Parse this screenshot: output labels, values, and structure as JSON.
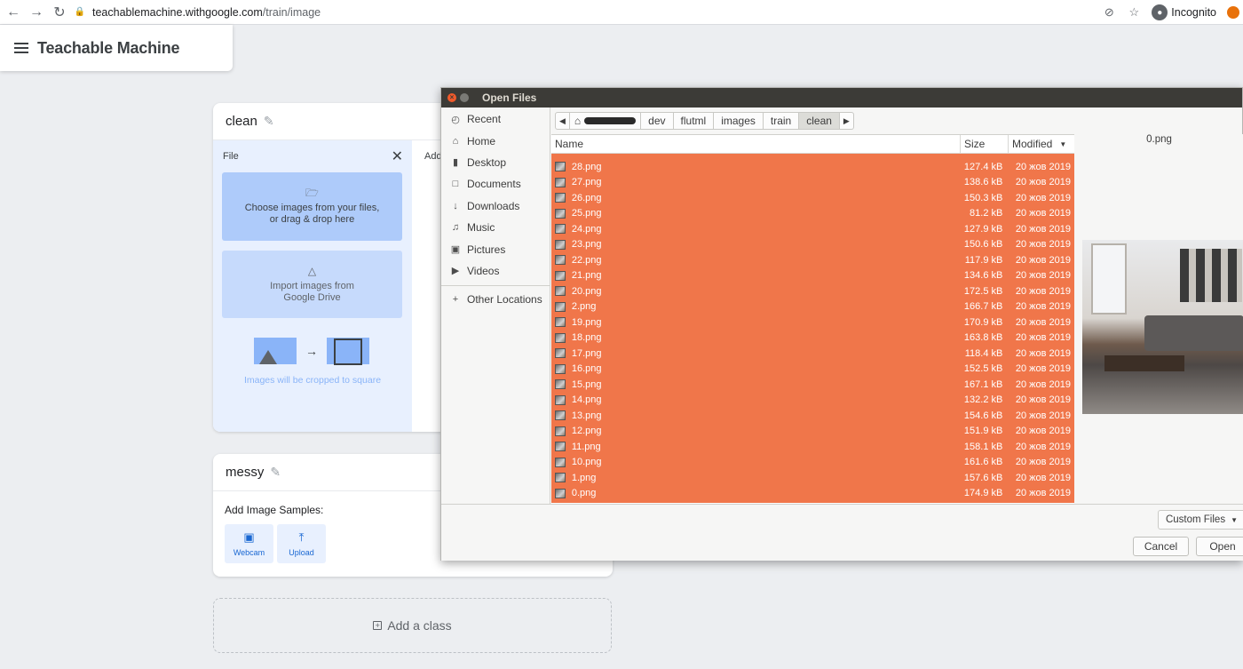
{
  "browser": {
    "url_domain": "teachablemachine.withgoogle.com",
    "url_path": "/train/image",
    "profile_label": "Incognito"
  },
  "app": {
    "title": "Teachable Machine"
  },
  "classes": [
    {
      "name": "clean",
      "file_panel": {
        "label": "File",
        "choose_text_line1": "Choose images from your files,",
        "choose_text_line2": "or drag & drop here",
        "drive_text_line1": "Import images from",
        "drive_text_line2": "Google Drive",
        "crop_note": "Images will be cropped to square"
      },
      "add_label_partial": "Add"
    },
    {
      "name": "messy",
      "samples_label": "Add Image Samples:",
      "webcam_label": "Webcam",
      "upload_label": "Upload"
    }
  ],
  "add_class_label": "Add a class",
  "dialog": {
    "title": "Open Files",
    "places": [
      {
        "label": "Recent",
        "icon": "clock-icon"
      },
      {
        "label": "Home",
        "icon": "home-icon"
      },
      {
        "label": "Desktop",
        "icon": "folder-icon"
      },
      {
        "label": "Documents",
        "icon": "document-icon"
      },
      {
        "label": "Downloads",
        "icon": "download-icon"
      },
      {
        "label": "Music",
        "icon": "music-icon"
      },
      {
        "label": "Pictures",
        "icon": "camera-icon"
      },
      {
        "label": "Videos",
        "icon": "video-icon"
      }
    ],
    "other_locations": "Other Locations",
    "path": [
      "dev",
      "flutml",
      "images",
      "train",
      "clean"
    ],
    "columns": {
      "name": "Name",
      "size": "Size",
      "modified": "Modified"
    },
    "files": [
      {
        "name": "28.png",
        "size": "127.4 kB",
        "modified": "20 жов 2019"
      },
      {
        "name": "27.png",
        "size": "138.6 kB",
        "modified": "20 жов 2019"
      },
      {
        "name": "26.png",
        "size": "150.3 kB",
        "modified": "20 жов 2019"
      },
      {
        "name": "25.png",
        "size": "81.2 kB",
        "modified": "20 жов 2019"
      },
      {
        "name": "24.png",
        "size": "127.9 kB",
        "modified": "20 жов 2019"
      },
      {
        "name": "23.png",
        "size": "150.6 kB",
        "modified": "20 жов 2019"
      },
      {
        "name": "22.png",
        "size": "117.9 kB",
        "modified": "20 жов 2019"
      },
      {
        "name": "21.png",
        "size": "134.6 kB",
        "modified": "20 жов 2019"
      },
      {
        "name": "20.png",
        "size": "172.5 kB",
        "modified": "20 жов 2019"
      },
      {
        "name": "2.png",
        "size": "166.7 kB",
        "modified": "20 жов 2019"
      },
      {
        "name": "19.png",
        "size": "170.9 kB",
        "modified": "20 жов 2019"
      },
      {
        "name": "18.png",
        "size": "163.8 kB",
        "modified": "20 жов 2019"
      },
      {
        "name": "17.png",
        "size": "118.4 kB",
        "modified": "20 жов 2019"
      },
      {
        "name": "16.png",
        "size": "152.5 kB",
        "modified": "20 жов 2019"
      },
      {
        "name": "15.png",
        "size": "167.1 kB",
        "modified": "20 жов 2019"
      },
      {
        "name": "14.png",
        "size": "132.2 kB",
        "modified": "20 жов 2019"
      },
      {
        "name": "13.png",
        "size": "154.6 kB",
        "modified": "20 жов 2019"
      },
      {
        "name": "12.png",
        "size": "151.9 kB",
        "modified": "20 жов 2019"
      },
      {
        "name": "11.png",
        "size": "158.1 kB",
        "modified": "20 жов 2019"
      },
      {
        "name": "10.png",
        "size": "161.6 kB",
        "modified": "20 жов 2019"
      },
      {
        "name": "1.png",
        "size": "157.6 kB",
        "modified": "20 жов 2019"
      },
      {
        "name": "0.png",
        "size": "174.9 kB",
        "modified": "20 жов 2019"
      }
    ],
    "selection_color": "#f0764a",
    "preview_name": "0.png",
    "filter_label": "Custom Files",
    "cancel_label": "Cancel",
    "open_label": "Open"
  }
}
